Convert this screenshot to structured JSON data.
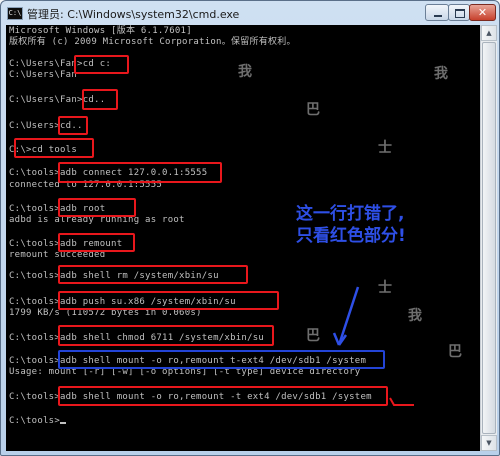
{
  "window": {
    "title": "管理员: C:\\Windows\\system32\\cmd.exe",
    "icon_label": "C:\\",
    "controls": {
      "minimize": "minimize-icon",
      "maximize": "maximize-icon",
      "close": "✕"
    }
  },
  "console": {
    "lines": [
      "Microsoft Windows [版本 6.1.7601]",
      "版权所有 (c) 2009 Microsoft Corporation。保留所有权利。",
      "",
      "C:\\Users\\Fan>cd c:",
      "C:\\Users\\Fan",
      "",
      "C:\\Users\\Fan>cd..",
      "",
      "C:\\Users>cd..",
      "",
      "C:\\>cd tools",
      "",
      "C:\\tools>adb connect 127.0.0.1:5555",
      "connected to 127.0.0.1:5555",
      "",
      "C:\\tools>adb root",
      "adbd is already running as root",
      "",
      "C:\\tools>adb remount",
      "remount succeeded",
      "",
      "C:\\tools>adb shell rm /system/xbin/su",
      "",
      "C:\\tools>adb push su.x86 /system/xbin/su",
      "1799 KB/s (110572 bytes in 0.060s)",
      "",
      "C:\\tools>adb shell chmod 6711 /system/xbin/su",
      "",
      "C:\\tools>adb shell mount -o ro,remount t-ext4 /dev/sdb1 /system",
      "Usage: mount [-r] [-w] [-o options] [-t type] device directory",
      "",
      "C:\\tools>adb shell mount -o ro,remount -t ext4 /dev/sdb1 /system",
      "",
      "C:\\tools>"
    ]
  },
  "annotation": {
    "line1": "这一行打错了,",
    "line2": "只看红色部分!"
  },
  "watermark": {
    "chars": [
      "我",
      "巴",
      "士",
      "我",
      "巴",
      "士",
      "我",
      "巴"
    ]
  },
  "colors": {
    "console_bg": "#000000",
    "console_text": "#c0c0c0",
    "highlight_red": "#e8171c",
    "highlight_blue": "#2344d6",
    "annotation_text": "#2e4fe6"
  },
  "scrollbar": {
    "up_arrow": "▲",
    "down_arrow": "▼"
  }
}
